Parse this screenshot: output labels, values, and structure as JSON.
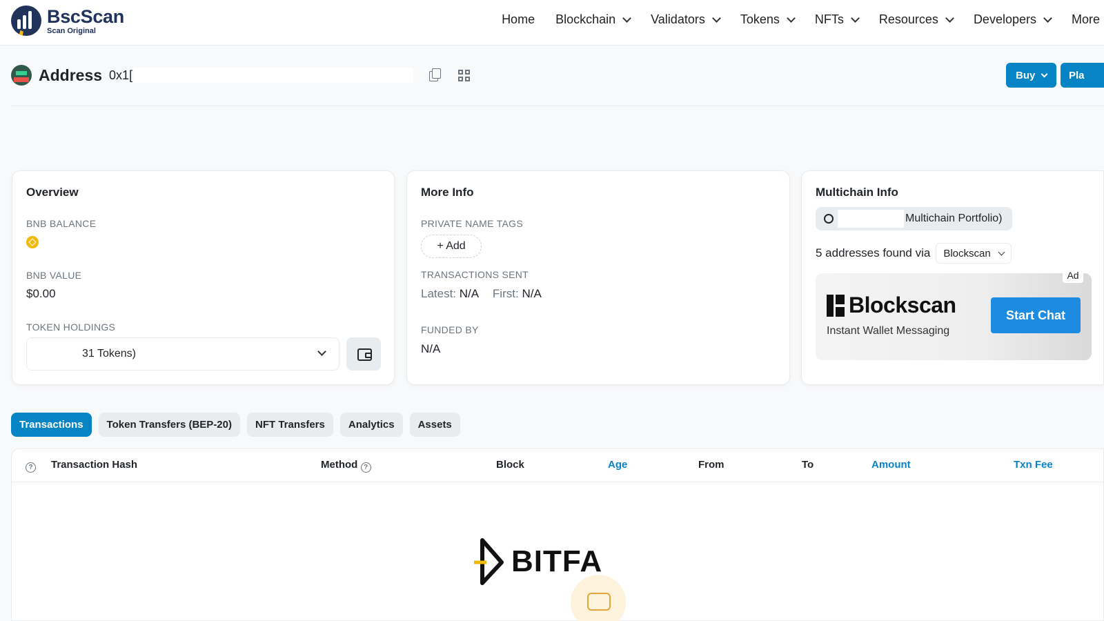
{
  "brand": {
    "name": "BscScan",
    "tagline": "Scan Original"
  },
  "nav": [
    "Home",
    "Blockchain",
    "Validators",
    "Tokens",
    "NFTs",
    "Resources",
    "Developers",
    "More"
  ],
  "address": {
    "label": "Address",
    "value": "0x1["
  },
  "actions": {
    "buy": "Buy",
    "play": "Pla"
  },
  "overview": {
    "title": "Overview",
    "bnb_balance_label": "BNB BALANCE",
    "bnb_value_label": "BNB VALUE",
    "bnb_value": "$0.00",
    "token_holdings_label": "TOKEN HOLDINGS",
    "token_holdings_value": "31 Tokens)"
  },
  "more_info": {
    "title": "More Info",
    "private_tags_label": "PRIVATE NAME TAGS",
    "add_label": "+ Add",
    "tx_sent_label": "TRANSACTIONS SENT",
    "latest_label": "Latest:",
    "latest_value": "N/A",
    "first_label": "First:",
    "first_value": "N/A",
    "funded_by_label": "FUNDED BY",
    "funded_by_value": "N/A"
  },
  "multichain": {
    "title": "Multichain Info",
    "portfolio_label": "Multichain Portfolio)",
    "found_text": "5 addresses found via",
    "found_source": "Blockscan",
    "ad": {
      "brand": "Blockscan",
      "subtitle": "Instant Wallet Messaging",
      "cta": "Start Chat",
      "tag": "Ad"
    }
  },
  "tabs": [
    "Transactions",
    "Token Transfers (BEP-20)",
    "NFT Transfers",
    "Analytics",
    "Assets"
  ],
  "table": {
    "columns": [
      "Transaction Hash",
      "Method",
      "Block",
      "Age",
      "From",
      "To",
      "Amount",
      "Txn Fee"
    ]
  },
  "watermark": "BITFA",
  "colors": {
    "primary": "#0784c3",
    "bnb": "#f0b90b",
    "brand_dark": "#21325b"
  }
}
